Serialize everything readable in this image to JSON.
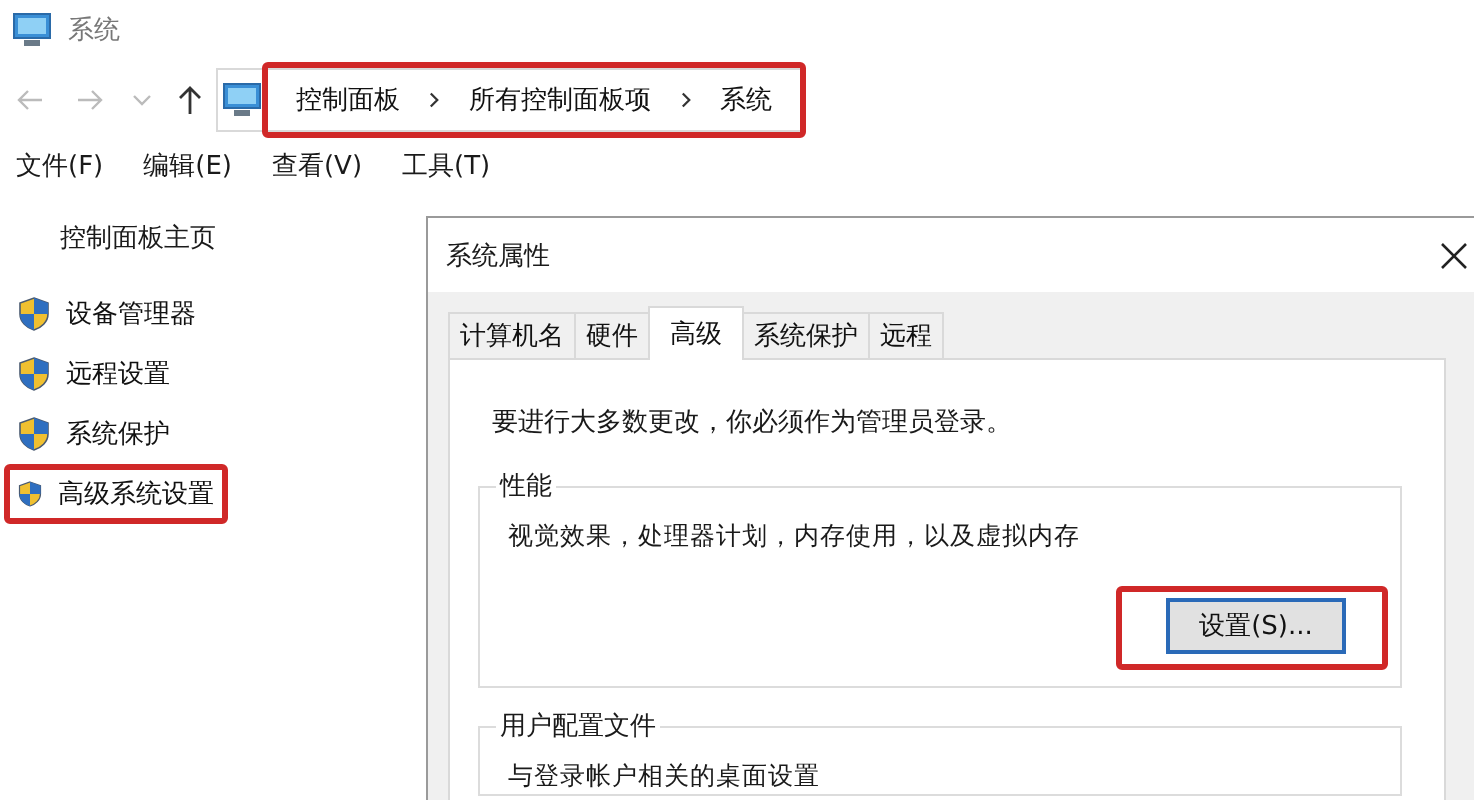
{
  "window": {
    "title": "系统"
  },
  "nav": {
    "address": [
      "控制面板",
      "所有控制面板项",
      "系统"
    ],
    "highlighted": true
  },
  "menu": [
    "文件(F)",
    "编辑(E)",
    "查看(V)",
    "工具(T)"
  ],
  "sidebar": {
    "home": "控制面板主页",
    "items": [
      {
        "label": "设备管理器",
        "highlighted": false
      },
      {
        "label": "远程设置",
        "highlighted": false
      },
      {
        "label": "系统保护",
        "highlighted": false
      },
      {
        "label": "高级系统设置",
        "highlighted": true
      }
    ]
  },
  "dialog": {
    "title": "系统属性",
    "tabs": [
      {
        "label": "计算机名",
        "selected": false
      },
      {
        "label": "硬件",
        "selected": false
      },
      {
        "label": "高级",
        "selected": true
      },
      {
        "label": "系统保护",
        "selected": false
      },
      {
        "label": "远程",
        "selected": false
      }
    ],
    "admin_note": "要进行大多数更改，你必须作为管理员登录。",
    "groups": [
      {
        "title": "性能",
        "description": "视觉效果，处理器计划，内存使用，以及虚拟内存",
        "button": {
          "label": "设置(S)...",
          "highlighted": true
        }
      },
      {
        "title": "用户配置文件",
        "description": "与登录帐户相关的桌面设置"
      }
    ]
  }
}
